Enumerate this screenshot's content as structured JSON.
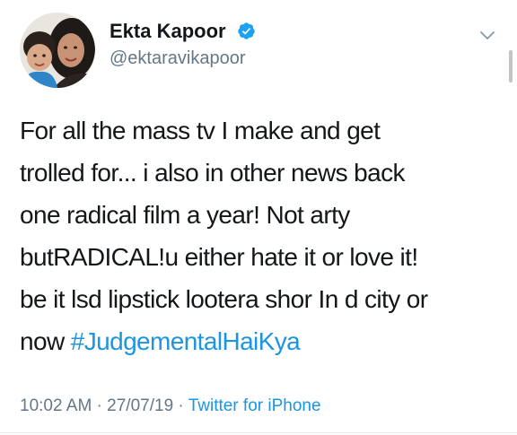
{
  "author": {
    "display_name": "Ekta Kapoor",
    "handle": "@ektaravikapoor",
    "verified_icon": "verified-badge-icon",
    "avatar_icon": "profile-avatar"
  },
  "menu_icon": "chevron-down-icon",
  "tweet": {
    "lines": [
      "For all the mass tv I make and get",
      "trolled for... i also in other news back",
      "one radical film a year! Not arty",
      "butRADICAL!u either hate it or love it!",
      "be it lsd lipstick lootera shor In d city or",
      "now "
    ],
    "hashtag": "#JudgementalHaiKya"
  },
  "meta": {
    "time": "10:02 AM",
    "separator": " · ",
    "date": "27/07/19",
    "source": "Twitter for iPhone"
  },
  "colors": {
    "text": "#14171a",
    "secondary": "#657786",
    "link": "#1b95e0",
    "verified": "#1da1f2"
  }
}
